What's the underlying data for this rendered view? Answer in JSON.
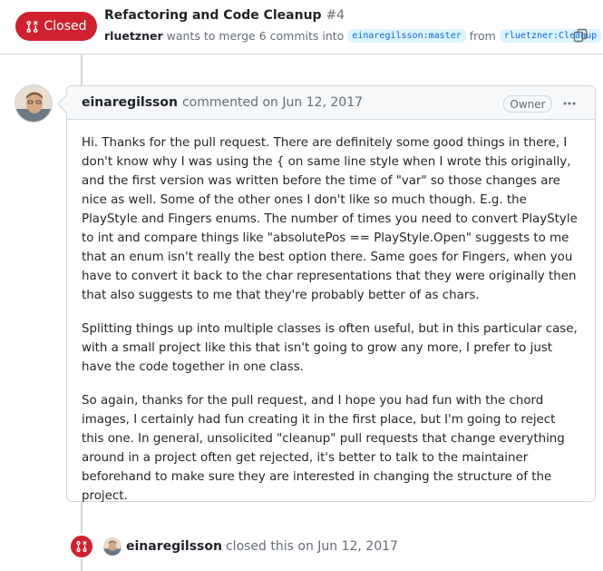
{
  "header": {
    "state_label": "Closed",
    "title": "Refactoring and Code Cleanup",
    "number": "#4",
    "author": "rluetzner",
    "merge_text": "wants to merge 6 commits into",
    "base_branch": "einaregilsson:master",
    "from_text": "from",
    "head_branch": "rluetzner:Cleanup",
    "icons": {
      "state": "git-pull-request-closed-icon",
      "copy": "copy-icon"
    }
  },
  "comment": {
    "author": "einaregilsson",
    "action": "commented on Jun 12, 2017",
    "role_badge": "Owner",
    "menu_icon": "kebab-horizontal-icon",
    "paragraphs": [
      "Hi. Thanks for the pull request. There are definitely some good things in there, I don't know why I was using the { on same line style when I wrote this originally, and the first version was written before the time of \"var\" so those changes are nice as well. Some of the other ones I don't like so much though. E.g. the PlayStyle and Fingers enums. The number of times you need to convert PlayStyle to int and compare things like \"absolutePos == PlayStyle.Open\" suggests to me that an enum isn't really the best option there. Same goes for Fingers, when you have to convert it back to the char representations that they were originally then that also suggests to me that they're probably better of as chars.",
      "Splitting things up into multiple classes is often useful, but in this particular case, with a small project like this that isn't going to grow any more, I prefer to just have the code together in one class.",
      "So again, thanks for the pull request, and I hope you had fun with the chord images, I certainly had fun creating it in the first place, but I'm going to reject this one. In general, unsolicited \"cleanup\" pull requests that change everything around in a project often get rejected, it's better to talk to the maintainer beforehand to make sure they are interested in changing the structure of the project."
    ]
  },
  "event": {
    "author": "einaregilsson",
    "action": "closed this on Jun 12, 2017",
    "icon": "git-pull-request-closed-icon"
  },
  "colors": {
    "closed_red": "#cf222e",
    "border": "#d0d7de",
    "muted_text": "#656d76",
    "link_blue": "#0969da"
  }
}
